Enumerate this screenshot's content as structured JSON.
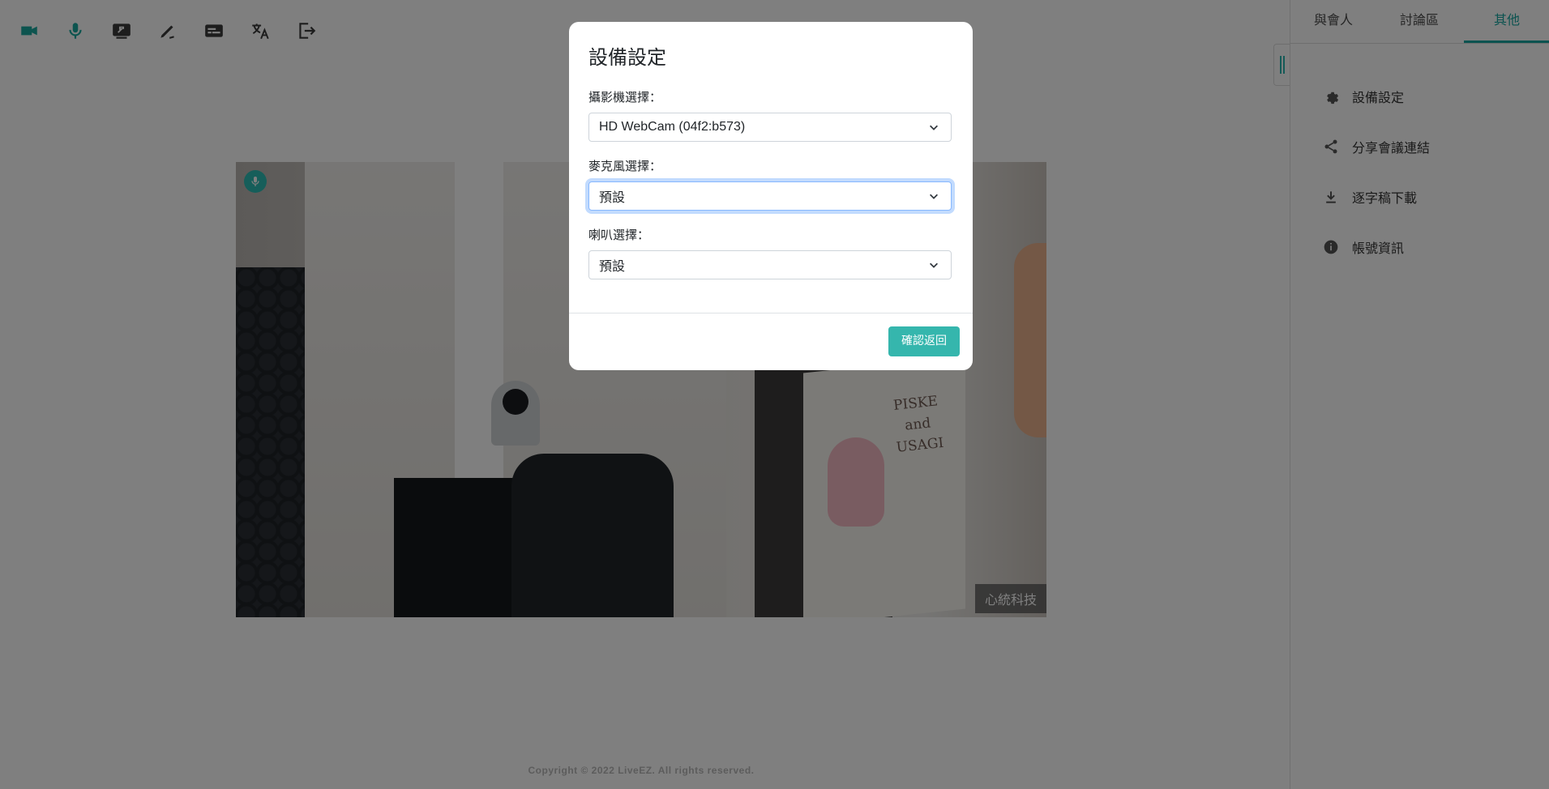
{
  "toolbar": {
    "icons": [
      "video-camera-icon",
      "microphone-icon",
      "screen-share-icon",
      "draw-icon",
      "subtitles-icon",
      "translate-icon",
      "exit-icon"
    ]
  },
  "video": {
    "name_tag": "心統科技",
    "poster_text": "PISKE\nand\nUSAGI"
  },
  "footer": {
    "copyright": "Copyright © 2022 LiveEZ. All rights reserved."
  },
  "panel": {
    "tabs": [
      {
        "label": "與會人"
      },
      {
        "label": "討論區"
      },
      {
        "label": "其他",
        "active": true
      }
    ],
    "menu": [
      {
        "label": "設備設定",
        "icon": "gear-icon"
      },
      {
        "label": "分享會議連結",
        "icon": "share-icon"
      },
      {
        "label": "逐字稿下載",
        "icon": "download-icon"
      },
      {
        "label": "帳號資訊",
        "icon": "info-icon"
      }
    ]
  },
  "modal": {
    "title": "設備設定",
    "camera_label": "攝影機選擇：",
    "camera_value": "HD WebCam (04f2:b573)",
    "mic_label": "麥克風選擇：",
    "mic_value": "預設",
    "speaker_label": "喇叭選擇：",
    "speaker_value": "預設",
    "confirm": "確認返回"
  },
  "colors": {
    "accent": "#17a6a0",
    "button": "#35b6ad"
  }
}
